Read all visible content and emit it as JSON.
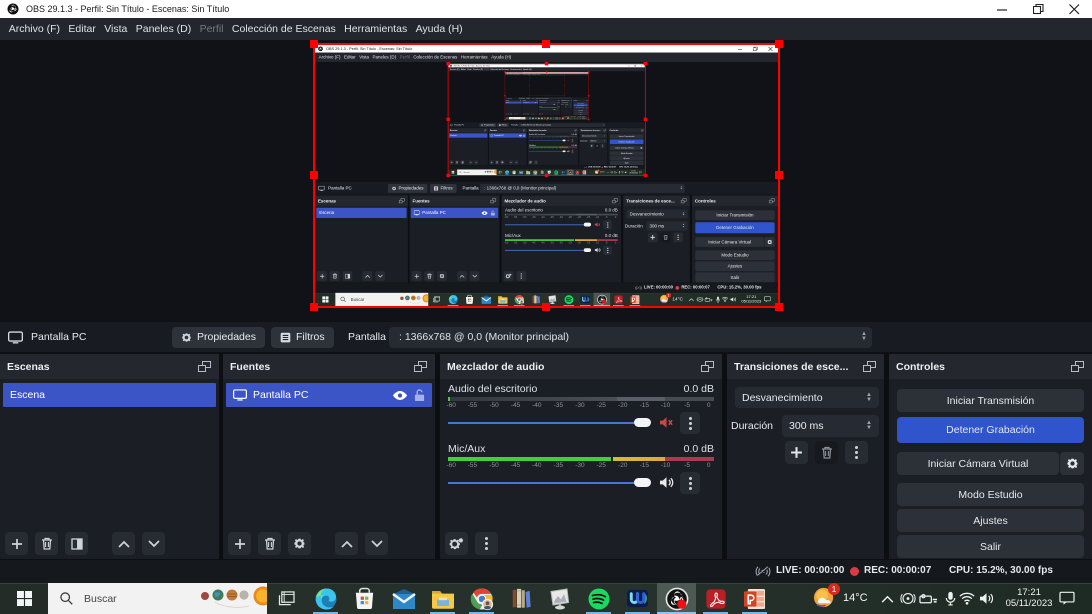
{
  "window": {
    "title": "OBS 29.1.3 - Perfil: Sin Título - Escenas: Sin Título",
    "buttons": {
      "minimize": "minimize",
      "restore": "restore",
      "close": "close"
    }
  },
  "menu": {
    "items": [
      "Archivo (F)",
      "Editar",
      "Vista",
      "Paneles (D)",
      "Perfil",
      "Colección de Escenas",
      "Herramientas",
      "Ayuda (H)"
    ],
    "disabled_item": "Perfil"
  },
  "context_bar": {
    "source_name": "Pantalla PC",
    "properties_label": "Propiedades",
    "filters_label": "Filtros",
    "property_label": "Pantalla",
    "property_value": ": 1366x768 @ 0,0 (Monitor principal)"
  },
  "scenes": {
    "title": "Escenas",
    "items": [
      "Escena"
    ],
    "selected": "Escena"
  },
  "sources": {
    "title": "Fuentes",
    "items": [
      "Pantalla PC"
    ],
    "selected": "Pantalla PC"
  },
  "mixer": {
    "title": "Mezclador de audio",
    "ticks": [
      "-60",
      "-55",
      "-50",
      "-45",
      "-40",
      "-35",
      "-30",
      "-25",
      "-20",
      "-15",
      "-10",
      "-5",
      "0"
    ],
    "channels": [
      {
        "name": "Audio del escritorio",
        "level": "0.0 dB",
        "muted": true
      },
      {
        "name": "Mic/Aux",
        "level": "0.0 dB",
        "muted": false
      }
    ]
  },
  "transitions": {
    "title": "Transiciones de esce...",
    "current": "Desvanecimiento",
    "duration_label": "Duración",
    "duration_value": "300 ms"
  },
  "controls": {
    "title": "Controles",
    "stream": "Iniciar Transmisión",
    "record": "Detener Grabación",
    "virtual_cam": "Iniciar Cámara Virtual",
    "studio_mode": "Modo Estudio",
    "settings": "Ajustes",
    "exit": "Salir"
  },
  "status_bar": {
    "live": "LIVE: 00:00:00",
    "rec": "REC: 00:00:07",
    "cpu": "CPU: 15.2%, 30.00 fps"
  },
  "taskbar": {
    "search_placeholder": "Buscar",
    "weather_temp": "14°C",
    "weather_badge": "1",
    "time": "17:21",
    "date": "05/11/2023",
    "apps": [
      "task-view",
      "edge",
      "microsoft-store",
      "mail",
      "file-explorer",
      "chrome",
      "calibre",
      "photos",
      "spotify",
      "blue-w-app",
      "obs-studio",
      "acrobat",
      "powerpoint"
    ],
    "active_app": "obs-studio",
    "tray_icons": [
      "chevron-up",
      "obs",
      "capture-device",
      "microphone",
      "wifi",
      "volume"
    ]
  },
  "colors": {
    "accent_blue": "#3b55c7",
    "record_button_blue": "#2f54cc",
    "source_outline_red": "#ff0000",
    "meter_green": "#47cc3e",
    "meter_yellow": "#dfbc3a",
    "taskbar_underline": "#76b9e8"
  }
}
